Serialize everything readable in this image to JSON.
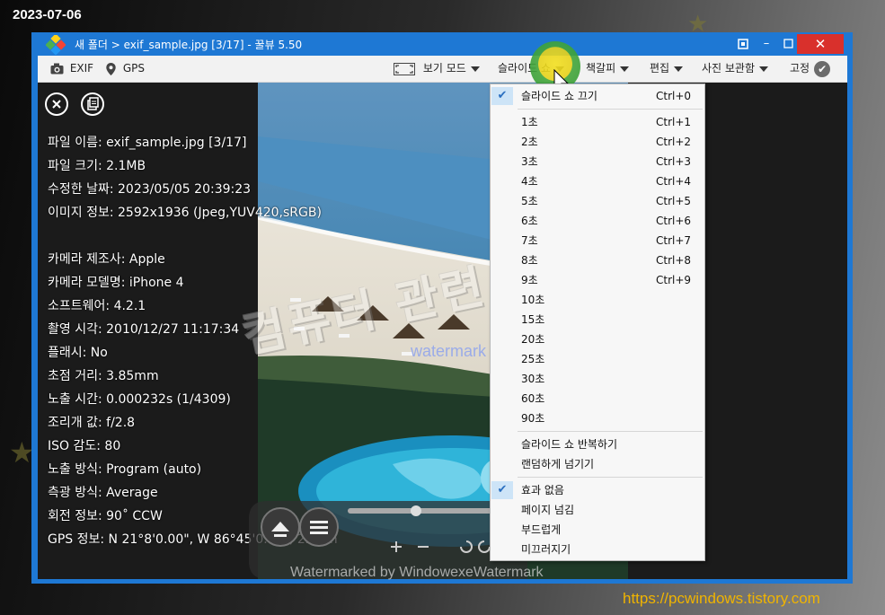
{
  "overlay": {
    "date": "2023-07-06",
    "site_url": "https://pcwindows.tistory.com"
  },
  "window": {
    "title": "새 폴더 > exif_sample.jpg [3/17] - 꿀뷰 5.50",
    "accent_color": "#1e78d4",
    "controls": [
      "restore-icon",
      "minimize-icon",
      "maximize-icon",
      "close-icon"
    ]
  },
  "toolbar": {
    "exif_label": "EXIF",
    "gps_label": "GPS",
    "view_mode_label": "보기 모드",
    "slideshow_label": "슬라이드 쇼",
    "bookmark_label": "책갈피",
    "edit_label": "편집",
    "photo_box_label": "사진 보관함",
    "pin_label": "고정"
  },
  "exif_info": {
    "file_name": "파일 이름: exif_sample.jpg [3/17]",
    "file_size": "파일 크기: 2.1MB",
    "modified": "수정한 날짜: 2023/05/05 20:39:23",
    "image_info": "이미지 정보: 2592x1936 (Jpeg,YUV420,sRGB)",
    "camera_make": "카메라 제조사: Apple",
    "camera_model": "카메라 모델명: iPhone 4",
    "software": "소프트웨어: 4.2.1",
    "shot_time": "촬영 시각: 2010/12/27 11:17:34",
    "flash": "플래시: No",
    "focal_length": "초점 거리: 3.85mm",
    "exposure_time": "노출 시간: 0.000232s (1/4309)",
    "aperture": "조리개 값: f/2.8",
    "iso": "ISO 감도: 80",
    "exposure_program": "노출 방식: Program (auto)",
    "metering": "측광 방식: Average",
    "rotation": "회전 정보: 90˚ CCW",
    "gps": "GPS 정보: N 21°8'0.00\", W 86°45'0.00\", 22.4m"
  },
  "watermarks": {
    "big": "컴퓨터 관련 정보",
    "small": "watermark by windowexe",
    "bottom": "Watermarked by WindowexeWatermark"
  },
  "slideshow_menu": {
    "items": [
      {
        "label": "슬라이드 쇼 끄기",
        "shortcut": "Ctrl+0",
        "checked": true
      },
      {
        "label": "1초",
        "shortcut": "Ctrl+1"
      },
      {
        "label": "2초",
        "shortcut": "Ctrl+2"
      },
      {
        "label": "3초",
        "shortcut": "Ctrl+3"
      },
      {
        "label": "4초",
        "shortcut": "Ctrl+4"
      },
      {
        "label": "5초",
        "shortcut": "Ctrl+5"
      },
      {
        "label": "6초",
        "shortcut": "Ctrl+6"
      },
      {
        "label": "7초",
        "shortcut": "Ctrl+7"
      },
      {
        "label": "8초",
        "shortcut": "Ctrl+8"
      },
      {
        "label": "9초",
        "shortcut": "Ctrl+9"
      },
      {
        "label": "10초"
      },
      {
        "label": "15초"
      },
      {
        "label": "20초"
      },
      {
        "label": "25초"
      },
      {
        "label": "30초"
      },
      {
        "label": "60초"
      },
      {
        "label": "90초"
      },
      {
        "label": "슬라이드 쇼 반복하기"
      },
      {
        "label": "랜덤하게 넘기기"
      },
      {
        "label": "효과 없음",
        "checked": true
      },
      {
        "label": "페이지 넘김"
      },
      {
        "label": "부드럽게"
      },
      {
        "label": "미끄러지기"
      }
    ]
  }
}
